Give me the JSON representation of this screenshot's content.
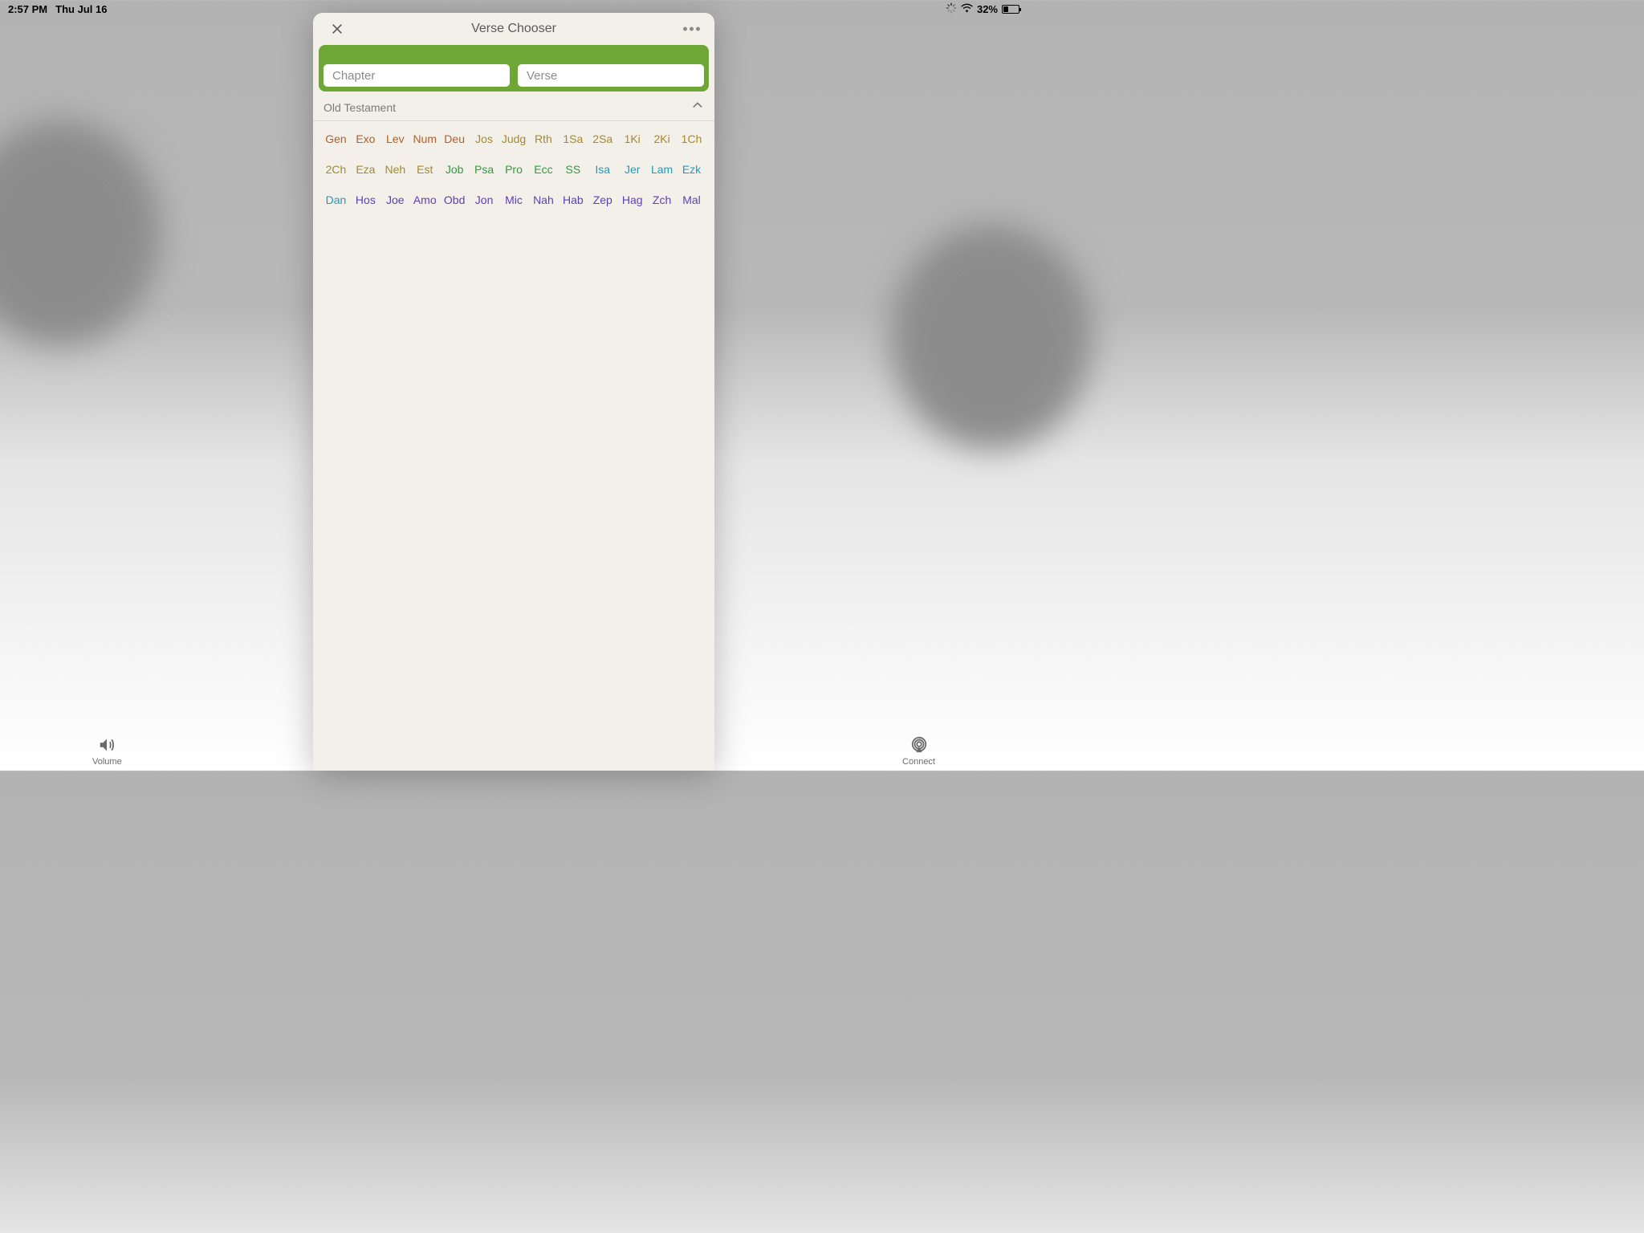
{
  "status": {
    "time": "2:57 PM",
    "date": "Thu Jul 16",
    "battery_pct": "32%"
  },
  "bottom": {
    "volume_label": "Volume",
    "connect_label": "Connect"
  },
  "modal": {
    "title": "Verse Chooser",
    "chapter_placeholder": "Chapter",
    "verse_placeholder": "Verse",
    "section_title": "Old Testament",
    "books": [
      {
        "abbr": "Gen",
        "cls": "c-brown"
      },
      {
        "abbr": "Exo",
        "cls": "c-brown"
      },
      {
        "abbr": "Lev",
        "cls": "c-brown"
      },
      {
        "abbr": "Num",
        "cls": "c-brown"
      },
      {
        "abbr": "Deu",
        "cls": "c-brown"
      },
      {
        "abbr": "Jos",
        "cls": "c-olive"
      },
      {
        "abbr": "Judg",
        "cls": "c-olive"
      },
      {
        "abbr": "Rth",
        "cls": "c-olive"
      },
      {
        "abbr": "1Sa",
        "cls": "c-olive"
      },
      {
        "abbr": "2Sa",
        "cls": "c-olive"
      },
      {
        "abbr": "1Ki",
        "cls": "c-olive"
      },
      {
        "abbr": "2Ki",
        "cls": "c-olive"
      },
      {
        "abbr": "1Ch",
        "cls": "c-olive"
      },
      {
        "abbr": "2Ch",
        "cls": "c-olive"
      },
      {
        "abbr": "Eza",
        "cls": "c-olive"
      },
      {
        "abbr": "Neh",
        "cls": "c-olive"
      },
      {
        "abbr": "Est",
        "cls": "c-olive"
      },
      {
        "abbr": "Job",
        "cls": "c-green"
      },
      {
        "abbr": "Psa",
        "cls": "c-green"
      },
      {
        "abbr": "Pro",
        "cls": "c-green"
      },
      {
        "abbr": "Ecc",
        "cls": "c-green"
      },
      {
        "abbr": "SS",
        "cls": "c-green"
      },
      {
        "abbr": "Isa",
        "cls": "c-teal"
      },
      {
        "abbr": "Jer",
        "cls": "c-teal"
      },
      {
        "abbr": "Lam",
        "cls": "c-teal"
      },
      {
        "abbr": "Ezk",
        "cls": "c-teal"
      },
      {
        "abbr": "Dan",
        "cls": "c-teal"
      },
      {
        "abbr": "Hos",
        "cls": "c-purple"
      },
      {
        "abbr": "Joe",
        "cls": "c-purple"
      },
      {
        "abbr": "Amo",
        "cls": "c-purple"
      },
      {
        "abbr": "Obd",
        "cls": "c-purple"
      },
      {
        "abbr": "Jon",
        "cls": "c-purple"
      },
      {
        "abbr": "Mic",
        "cls": "c-purple"
      },
      {
        "abbr": "Nah",
        "cls": "c-purple"
      },
      {
        "abbr": "Hab",
        "cls": "c-purple"
      },
      {
        "abbr": "Zep",
        "cls": "c-purple"
      },
      {
        "abbr": "Hag",
        "cls": "c-purple"
      },
      {
        "abbr": "Zch",
        "cls": "c-purple"
      },
      {
        "abbr": "Mal",
        "cls": "c-purple"
      }
    ]
  }
}
